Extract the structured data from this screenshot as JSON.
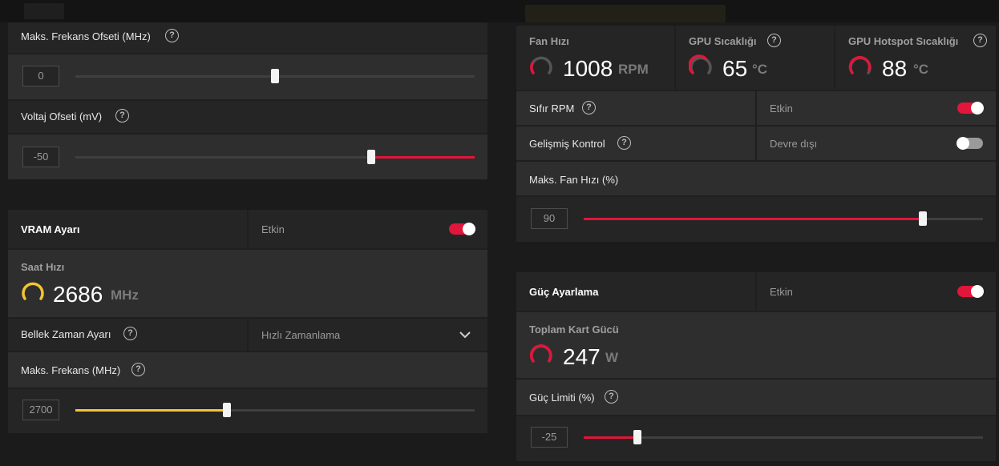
{
  "colors": {
    "accent_red": "#e0163a",
    "accent_yellow": "#f3c531",
    "toggle_off": "#9a9a9a"
  },
  "gpu_tuning": {
    "max_freq_offset": {
      "label": "Maks. Frekans Ofseti (MHz)",
      "value": "0",
      "level": 0.5
    },
    "voltage_offset": {
      "label": "Voltaj Ofseti (mV)",
      "value": "-50",
      "level": 0.74
    }
  },
  "vram": {
    "title": "VRAM Ayarı",
    "state_label": "Etkin",
    "toggle_on": true,
    "clock": {
      "label": "Saat Hızı",
      "value": "2686",
      "unit": "MHz"
    },
    "memory_timing": {
      "label": "Bellek Zaman Ayarı",
      "value": "Hızlı Zamanlama"
    },
    "max_freq": {
      "label": "Maks. Frekans (MHz)",
      "value": "2700",
      "level": 0.38
    }
  },
  "fan": {
    "metrics": [
      {
        "label": "Fan Hızı",
        "value": "1008",
        "unit": "RPM",
        "help": false
      },
      {
        "label": "GPU Sıcaklığı",
        "value": "65",
        "unit": "°C",
        "help": true
      },
      {
        "label": "GPU Hotspot Sıcaklığı",
        "value": "88",
        "unit": "°C",
        "help": true
      }
    ],
    "zero_rpm": {
      "label": "Sıfır RPM",
      "state_label": "Etkin",
      "toggle_on": true
    },
    "advanced_control": {
      "label": "Gelişmiş Kontrol",
      "state_label": "Devre dışı",
      "toggle_on": false
    },
    "max_fan_speed": {
      "label": "Maks. Fan Hızı (%)",
      "value": "90",
      "level": 0.85
    }
  },
  "power": {
    "title": "Güç Ayarlama",
    "state_label": "Etkin",
    "toggle_on": true,
    "board_power": {
      "label": "Toplam Kart Gücü",
      "value": "247",
      "unit": "W"
    },
    "power_limit": {
      "label": "Güç Limiti (%)",
      "value": "-25",
      "level": 0.135
    }
  },
  "icons": {
    "help": "help-circle-icon",
    "gauge": "gauge-icon",
    "dropdown": "chevron-down-icon"
  },
  "help_glyph": "?"
}
